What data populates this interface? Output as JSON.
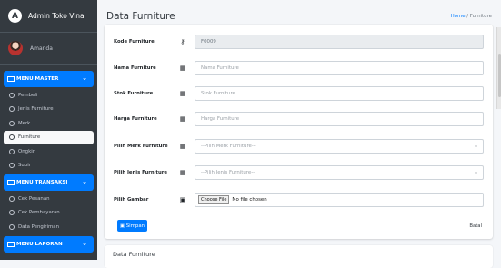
{
  "brand": {
    "logo": "A",
    "title": "Admin Toko Vina"
  },
  "user": {
    "name": "Amanda"
  },
  "sidebar": {
    "sections": [
      {
        "title": "MENU MASTER",
        "items": [
          "Pembeli",
          "Jenis Furniture",
          "Merk",
          "Furniture",
          "Ongkir",
          "Supir"
        ]
      },
      {
        "title": "MENU TRANSAKSI",
        "items": [
          "Cek Pesanan",
          "Cek Pembayaran",
          "Data Pengiriman"
        ]
      },
      {
        "title": "MENU LAPORAN",
        "items": []
      }
    ]
  },
  "page": {
    "title": "Data Furniture",
    "breadcrumb_home": "Home",
    "breadcrumb_current": "Furniture"
  },
  "form": {
    "code": {
      "label": "Kode Furniture",
      "value": "F0009"
    },
    "name": {
      "label": "Nama Furniture",
      "placeholder": "Nama Furniture"
    },
    "stock": {
      "label": "Stok Furniture",
      "placeholder": "Stok Furniture"
    },
    "price": {
      "label": "Harga Furniture",
      "placeholder": "Harga Furniture"
    },
    "brand": {
      "label": "Pilih Merk Furniture",
      "selected": "--Pilih Merk Furniture--"
    },
    "type": {
      "label": "Pilih Jenis Furniture",
      "selected": "--Pilih Jenis Furniture--"
    },
    "image": {
      "label": "Pilih Gambar",
      "button": "Choose File",
      "status": "No file chosen"
    },
    "save": "Simpan",
    "cancel": "Batal"
  },
  "bottom_card": {
    "title": "Data Furniture"
  }
}
